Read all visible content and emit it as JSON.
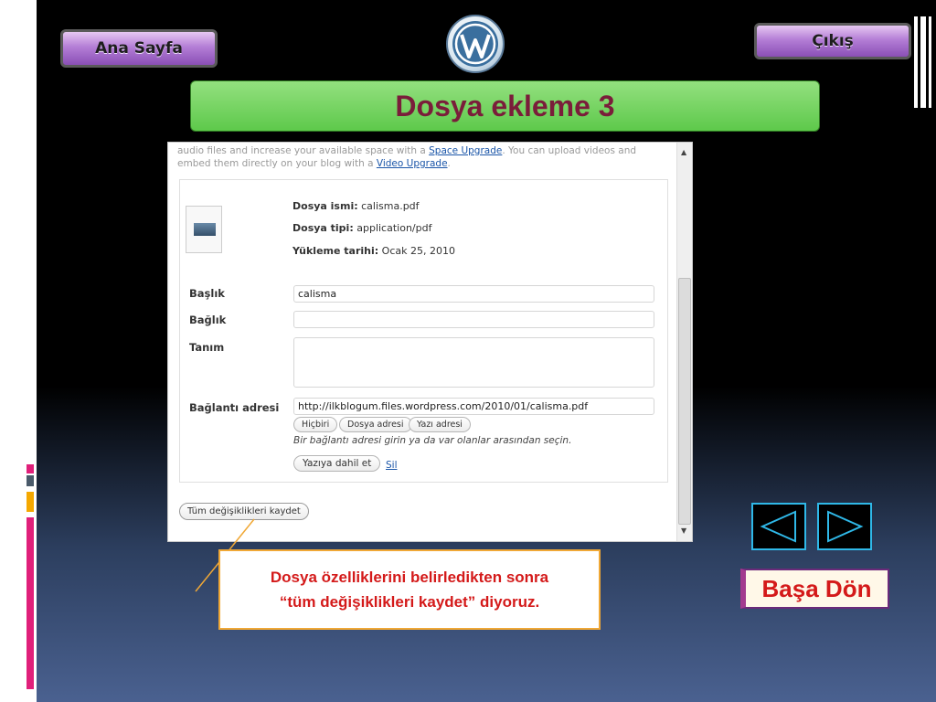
{
  "nav": {
    "home_label": "Ana Sayfa",
    "exit_label": "Çıkış"
  },
  "slide": {
    "title": "Dosya ekleme 3"
  },
  "upload_panel": {
    "top_text_1": "audio files and increase your available space with a ",
    "top_link_1": "Space Upgrade",
    "top_text_2": ". You can upload videos and embed them directly on your blog with a ",
    "top_link_2": "Video Upgrade",
    "top_text_3": ".",
    "file_name_label": "Dosya ismi:",
    "file_name_value": "calisma.pdf",
    "file_type_label": "Dosya tipi:",
    "file_type_value": "application/pdf",
    "upload_date_label": "Yükleme tarihi:",
    "upload_date_value": "Ocak 25, 2010",
    "title_label": "Başlık",
    "title_value": "calisma",
    "caption_label": "Bağlık",
    "caption_value": "",
    "description_label": "Tanım",
    "description_value": "",
    "link_label": "Bağlantı adresi",
    "link_value": "http://ilkblogum.files.wordpress.com/2010/01/calisma.pdf",
    "link_none": "Hiçbiri",
    "link_file": "Dosya adresi",
    "link_post": "Yazı adresi",
    "link_hint": "Bir bağlantı adresi girin ya da var olanlar arasından seçin.",
    "insert_label": "Yazıya dahil et",
    "delete_label": "Sil",
    "save_all_label": "Tüm değişiklikleri kaydet"
  },
  "callout": {
    "line1": "Dosya özelliklerini belirledikten sonra",
    "line2": "“tüm değişiklikleri kaydet” diyoruz."
  },
  "footer_nav": {
    "back_to_start": "Başa Dön"
  },
  "colors": {
    "title_text": "#7a1d3a",
    "title_bg": "#6fd25a",
    "callout_text": "#d41a1a",
    "callout_border": "#f0a836",
    "arrow_border": "#2fb8e8"
  }
}
